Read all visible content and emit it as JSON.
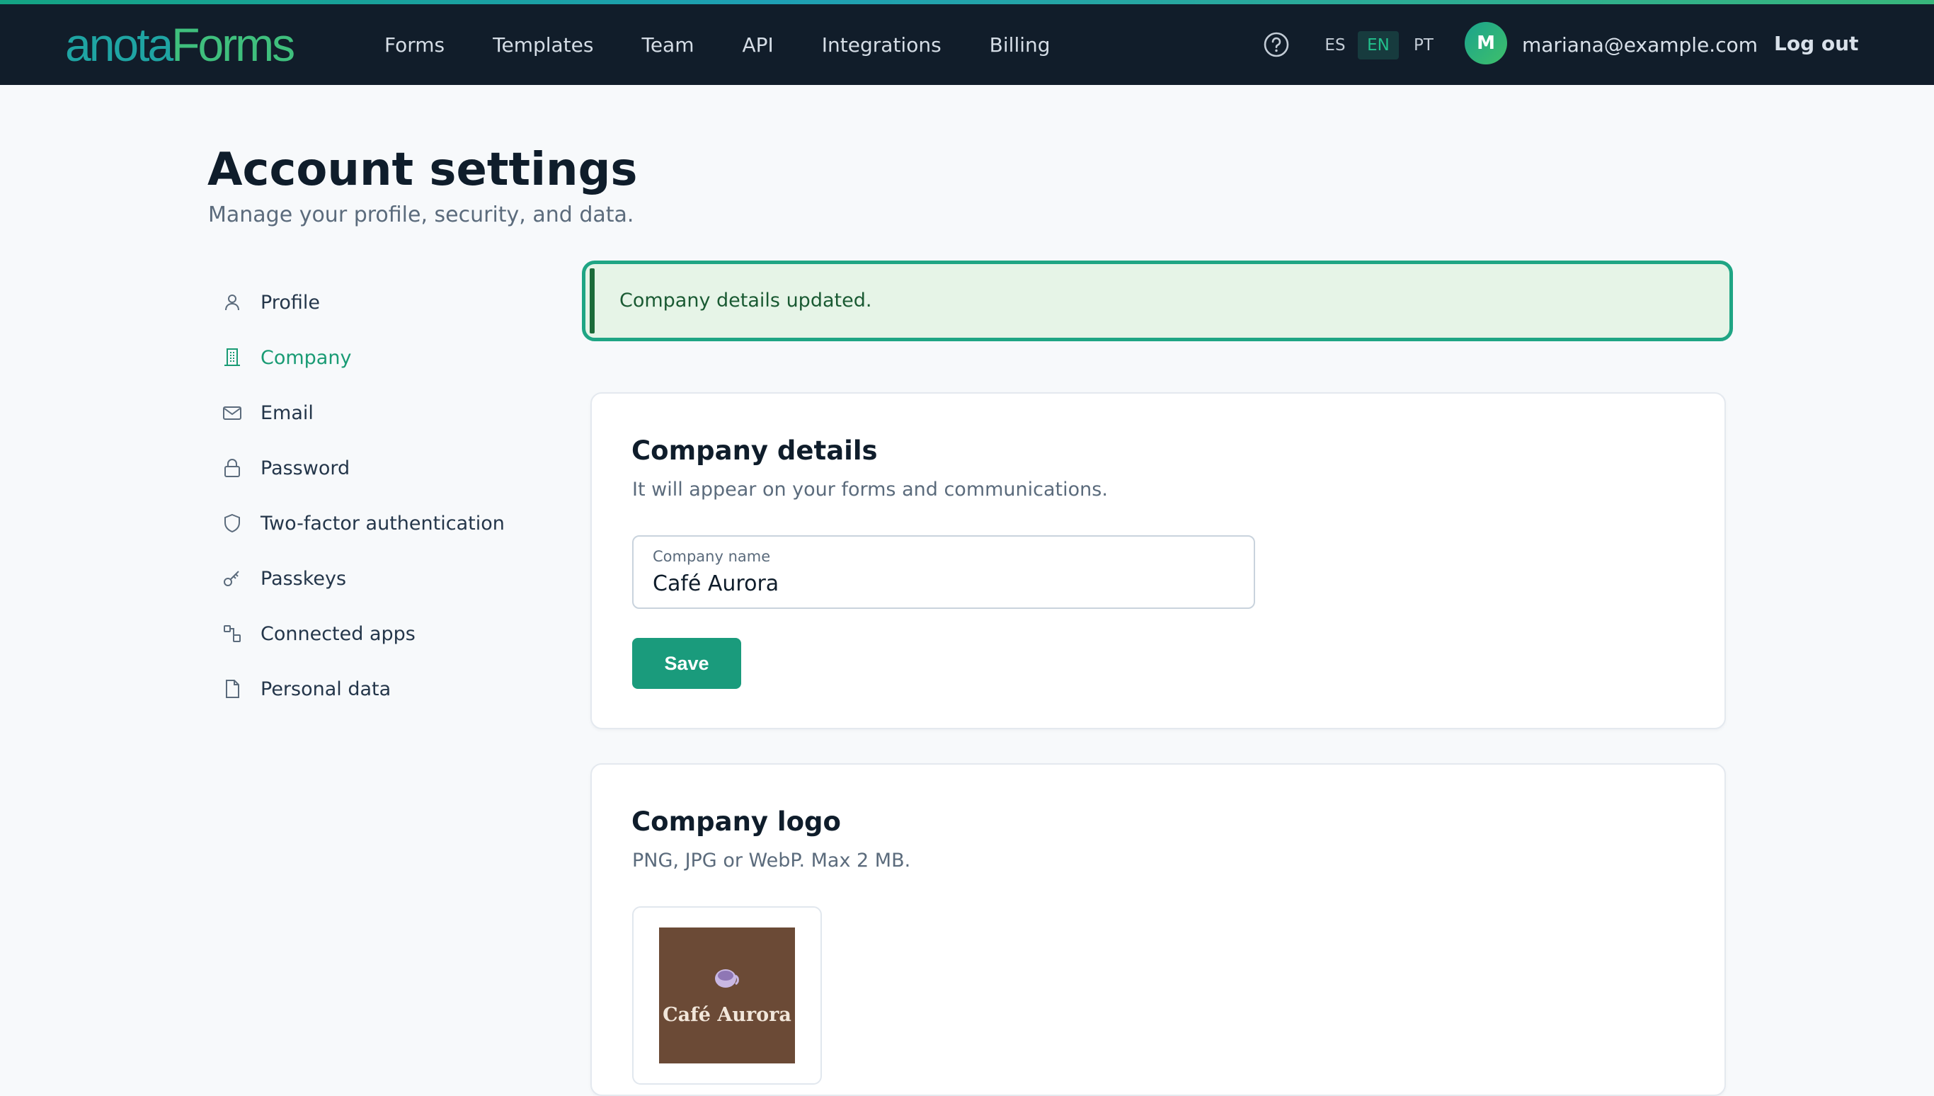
{
  "brand": {
    "part1": "anota",
    "part2": "Forms"
  },
  "nav": {
    "links": [
      "Forms",
      "Templates",
      "Team",
      "API",
      "Integrations",
      "Billing"
    ],
    "languages": [
      "ES",
      "EN",
      "PT"
    ],
    "active_language": "EN",
    "avatar_initial": "M",
    "user_email": "mariana@example.com",
    "logout_label": "Log out"
  },
  "page": {
    "title": "Account settings",
    "subtitle": "Manage your profile, security, and data."
  },
  "sidebar": {
    "items": [
      {
        "label": "Profile",
        "icon": "user-icon"
      },
      {
        "label": "Company",
        "icon": "building-icon",
        "active": true
      },
      {
        "label": "Email",
        "icon": "mail-icon"
      },
      {
        "label": "Password",
        "icon": "lock-icon"
      },
      {
        "label": "Two-factor authentication",
        "icon": "shield-icon"
      },
      {
        "label": "Passkeys",
        "icon": "key-icon"
      },
      {
        "label": "Connected apps",
        "icon": "connected-apps-icon"
      },
      {
        "label": "Personal data",
        "icon": "file-icon"
      }
    ]
  },
  "alert": {
    "message": "Company details updated."
  },
  "company_details": {
    "title": "Company details",
    "subtitle": "It will appear on your forms and communications.",
    "field_label": "Company name",
    "field_value": "Café Aurora",
    "save_label": "Save"
  },
  "company_logo": {
    "title": "Company logo",
    "subtitle": "PNG, JPG or WebP. Max 2 MB.",
    "image_text": "Café Aurora"
  },
  "colors": {
    "navbar_bg": "#111d2a",
    "accent": "#1a9b7c",
    "alert_bg": "#e6f4e7",
    "logo_bg": "#6b4a36"
  }
}
